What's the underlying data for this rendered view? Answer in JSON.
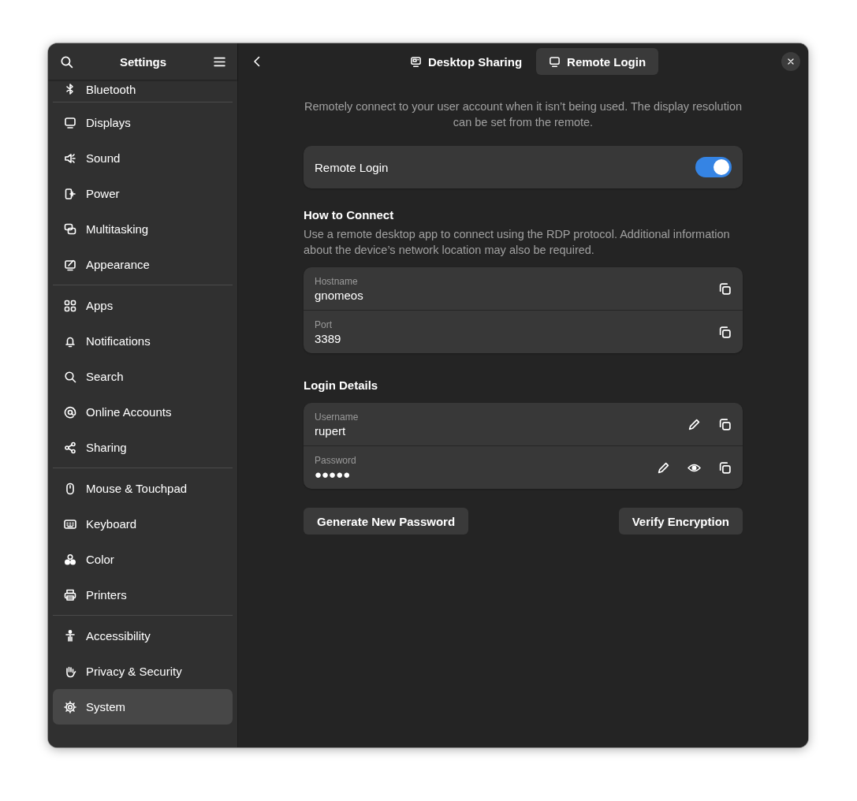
{
  "window": {
    "title": "Settings"
  },
  "sidebar": {
    "groups": [
      {
        "items": [
          {
            "label": "Bluetooth",
            "selected": false
          }
        ]
      },
      {
        "items": [
          {
            "label": "Displays",
            "selected": false
          },
          {
            "label": "Sound",
            "selected": false
          },
          {
            "label": "Power",
            "selected": false
          },
          {
            "label": "Multitasking",
            "selected": false
          },
          {
            "label": "Appearance",
            "selected": false
          }
        ]
      },
      {
        "items": [
          {
            "label": "Apps",
            "selected": false
          },
          {
            "label": "Notifications",
            "selected": false
          },
          {
            "label": "Search",
            "selected": false
          },
          {
            "label": "Online Accounts",
            "selected": false
          },
          {
            "label": "Sharing",
            "selected": false
          }
        ]
      },
      {
        "items": [
          {
            "label": "Mouse & Touchpad",
            "selected": false
          },
          {
            "label": "Keyboard",
            "selected": false
          },
          {
            "label": "Color",
            "selected": false
          },
          {
            "label": "Printers",
            "selected": false
          }
        ]
      },
      {
        "items": [
          {
            "label": "Accessibility",
            "selected": false
          },
          {
            "label": "Privacy & Security",
            "selected": false
          },
          {
            "label": "System",
            "selected": true
          }
        ]
      }
    ]
  },
  "header": {
    "tabs": [
      {
        "label": "Desktop Sharing",
        "selected": false
      },
      {
        "label": "Remote Login",
        "selected": true
      }
    ]
  },
  "page": {
    "description": "Remotely connect to your user account when it isn’t being used. The display resolution can be set from the remote.",
    "toggle": {
      "label": "Remote Login",
      "on": true
    },
    "sections": [
      {
        "heading": "How to Connect",
        "description": "Use a remote desktop app to connect using the RDP protocol. Additional information about the device’s network location may also be required.",
        "rows": [
          {
            "label": "Hostname",
            "value": "gnomeos",
            "actions": [
              {
                "kind": "copy"
              }
            ]
          },
          {
            "label": "Port",
            "value": "3389",
            "actions": [
              {
                "kind": "copy"
              }
            ]
          }
        ]
      },
      {
        "heading": "Login Details",
        "rows": [
          {
            "label": "Username",
            "value": "rupert",
            "actions": [
              {
                "kind": "edit"
              },
              {
                "kind": "copy"
              }
            ]
          },
          {
            "label": "Password",
            "value": "●●●●●",
            "actions": [
              {
                "kind": "edit"
              },
              {
                "kind": "reveal"
              },
              {
                "kind": "copy"
              }
            ]
          }
        ]
      }
    ],
    "buttons": [
      {
        "label": "Generate New Password"
      },
      {
        "label": "Verify Encryption"
      }
    ]
  }
}
